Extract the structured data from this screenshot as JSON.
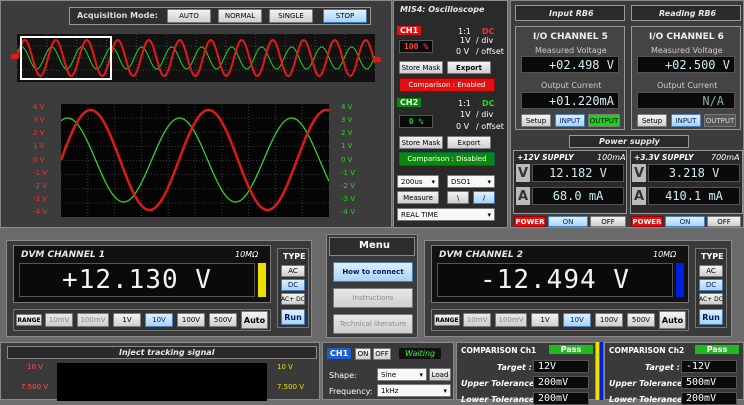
{
  "acq": {
    "label": "Acquisition Mode:",
    "buttons": [
      "AUTO",
      "NORMAL",
      "SINGLE",
      "STOP"
    ],
    "active": "STOP"
  },
  "scope": {
    "title": "MIS4: Oscilloscope",
    "ch1": {
      "name": "CH1",
      "ratio": "1:1",
      "coupling": "DC",
      "percent": "100 %",
      "vdiv": "1V",
      "vdiv_unit": "/ div",
      "offset": "0 V",
      "offset_unit": "/ offset",
      "store": "Store Mask",
      "export": "Export",
      "comparison": "Comparison : Enabled"
    },
    "ch2": {
      "name": "CH2",
      "ratio": "1:1",
      "coupling": "DC",
      "percent": "0 %",
      "vdiv": "1V",
      "vdiv_unit": "/ div",
      "offset": "0 V",
      "offset_unit": "/ offset",
      "store": "Store Mask",
      "export": "Export",
      "comparison": "Comparison : Disabled"
    },
    "timebase": "200us",
    "source": "DSO1",
    "measure": "Measure",
    "slope_down": "\\",
    "slope_up": "/",
    "mode": "REAL TIME",
    "left_ticks": [
      "4 V",
      "3 V",
      "2 V",
      "1 V",
      "0 V",
      "-1 V",
      "-2 V",
      "-3 V",
      "-4 V"
    ],
    "right_ticks": [
      "4 V",
      "3 V",
      "2 V",
      "1 V",
      "0 V",
      "-1 V",
      "-2 V",
      "-3 V",
      "-4 V"
    ]
  },
  "io": {
    "header_left": "Input RB6",
    "header_right": "Reading RB6",
    "ch5": {
      "title": "I/O CHANNEL 5",
      "v_label": "Measured Voltage",
      "v": "+02.498",
      "v_unit": "V",
      "i_label": "Output Current",
      "i": "+01.220",
      "i_unit": "mA",
      "setup": "Setup",
      "input": "INPUT",
      "output": "OUTPUT"
    },
    "ch6": {
      "title": "I/O CHANNEL 6",
      "v_label": "Measured Voltage",
      "v": "+02.500",
      "v_unit": "V",
      "i_label": "Output Current",
      "i": "N/A",
      "setup": "Setup",
      "input": "INPUT",
      "output": "OUTPUT"
    }
  },
  "power": {
    "title": "Power supply",
    "s12": {
      "name": "+12V SUPPLY",
      "limit": "100mA",
      "v": "12.182",
      "v_unit": "V",
      "a": "68.0",
      "a_unit": "mA",
      "power": "POWER",
      "on": "ON",
      "off": "OFF"
    },
    "s33": {
      "name": "+3.3V SUPPLY",
      "limit": "700mA",
      "v": "3.218",
      "v_unit": "V",
      "a": "410.1",
      "a_unit": "mA",
      "power": "POWER",
      "on": "ON",
      "off": "OFF"
    }
  },
  "dvm1": {
    "title": "DVM CHANNEL 1",
    "imp": "10MΩ",
    "value": "+12.130",
    "unit": "V",
    "bar": "#f0e000",
    "type": "TYPE",
    "types": [
      "AC",
      "DC",
      "AC+ DC"
    ],
    "run": "Run",
    "range": "RANGE",
    "ranges": [
      "10mV",
      "100mV",
      "1V",
      "10V",
      "100V",
      "500V"
    ],
    "auto": "Auto"
  },
  "dvm2": {
    "title": "DVM CHANNEL 2",
    "imp": "10MΩ",
    "value": "-12.494",
    "unit": "V",
    "bar": "#0020e0",
    "type": "TYPE",
    "types": [
      "AC",
      "DC",
      "AC+ DC"
    ],
    "run": "Run",
    "range": "RANGE",
    "ranges": [
      "10mV",
      "100mV",
      "1V",
      "10V",
      "100V",
      "500V"
    ],
    "auto": "Auto"
  },
  "menu": {
    "title": "Menu",
    "items": [
      "How to connect",
      "Instructions",
      "Technical literature"
    ]
  },
  "inject": {
    "title": "Inject tracking signal",
    "ticks_l": [
      "10 V",
      "7.500 V"
    ],
    "ticks_r": [
      "10 V",
      "7.500 V"
    ],
    "ch": "CH1",
    "on": "ON",
    "off": "OFF",
    "status": "Waiting",
    "shape_label": "Shape:",
    "shape": "Sine",
    "load": "Load",
    "freq_label": "Frequency:",
    "freq": "1kHz"
  },
  "cmp1": {
    "title": "COMPARISON Ch1",
    "pass": "Pass",
    "target_label": "Target :",
    "target": "12",
    "unit": "V",
    "upper_label": "Upper Tolerance :",
    "upper": "200m",
    "upper_unit": "V",
    "lower_label": "Lower Tolerance :",
    "lower": "200m",
    "lower_unit": "V"
  },
  "cmp2": {
    "title": "COMPARISON Ch2",
    "pass": "Pass",
    "target_label": "Target :",
    "target": "-12",
    "unit": "V",
    "upper_label": "Upper Tolerance :",
    "upper": "500m",
    "upper_unit": "V",
    "lower_label": "Lower Tolerance :",
    "lower": "200m",
    "lower_unit": "V"
  }
}
